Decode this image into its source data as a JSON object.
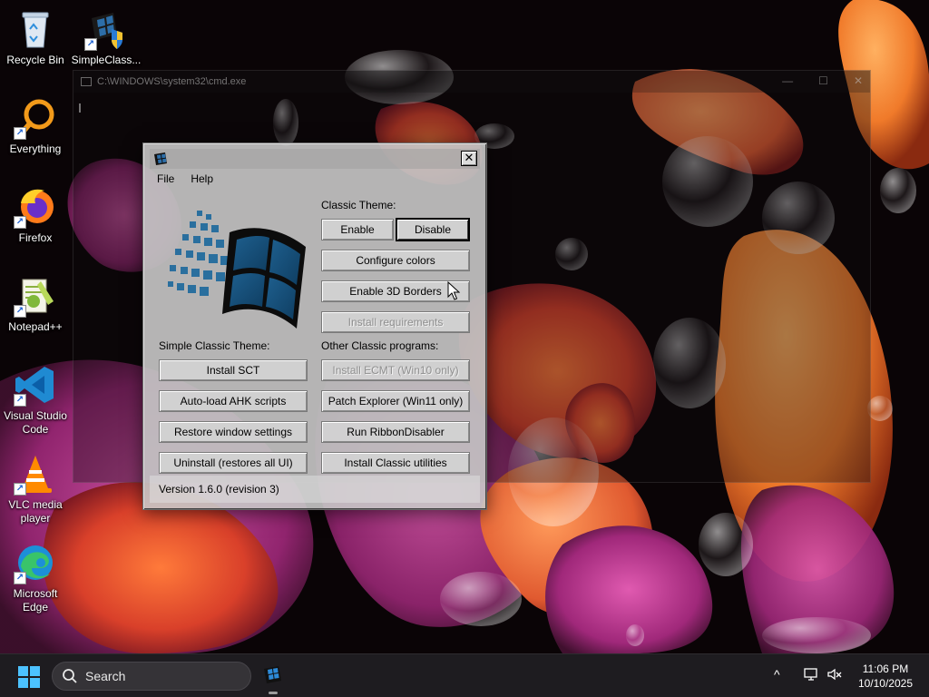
{
  "desktop": {
    "icons": [
      {
        "label": "Recycle Bin",
        "icon": "recycle-bin-icon"
      },
      {
        "label": "SimpleClass...",
        "icon": "simple-classic-icon"
      },
      {
        "label": "Everything",
        "icon": "everything-search-icon"
      },
      {
        "label": "Firefox",
        "icon": "firefox-icon"
      },
      {
        "label": "Notepad++",
        "icon": "notepad-plus-plus-icon"
      },
      {
        "label": "Visual Studio Code",
        "icon": "vscode-icon"
      },
      {
        "label": "VLC media player",
        "icon": "vlc-icon"
      },
      {
        "label": "Microsoft Edge",
        "icon": "edge-icon"
      }
    ]
  },
  "cmd_window": {
    "title": "C:\\WINDOWS\\system32\\cmd.exe"
  },
  "dialog": {
    "menu": [
      "File",
      "Help"
    ],
    "close_glyph": "✕",
    "classic_theme_label": "Classic Theme:",
    "enable_label": "Enable",
    "disable_label": "Disable",
    "configure_colors_label": "Configure colors",
    "enable_3d_borders_label": "Enable 3D Borders",
    "install_requirements_label": "Install requirements",
    "simple_classic_theme_label": "Simple Classic Theme:",
    "other_programs_label": "Other Classic programs:",
    "install_sct_label": "Install SCT",
    "autoload_ahk_label": "Auto-load AHK scripts",
    "restore_window_label": "Restore window settings",
    "uninstall_label": "Uninstall (restores all UI)",
    "install_ecmt_label": "Install ECMT (Win10 only)",
    "patch_explorer_label": "Patch Explorer (Win11 only)",
    "run_ribbon_label": "Run RibbonDisabler",
    "install_classic_utils_label": "Install Classic utilities",
    "version": "Version 1.6.0 (revision 3)"
  },
  "taskbar": {
    "search_placeholder": "Search",
    "time": "11:06 PM",
    "date": "10/10/2025",
    "tray_chevron": "^"
  },
  "colors": {
    "accent": "#0b5fa8",
    "taskbar_bg": "#1e1c20",
    "dialog_bg": "#c8c8c8"
  }
}
